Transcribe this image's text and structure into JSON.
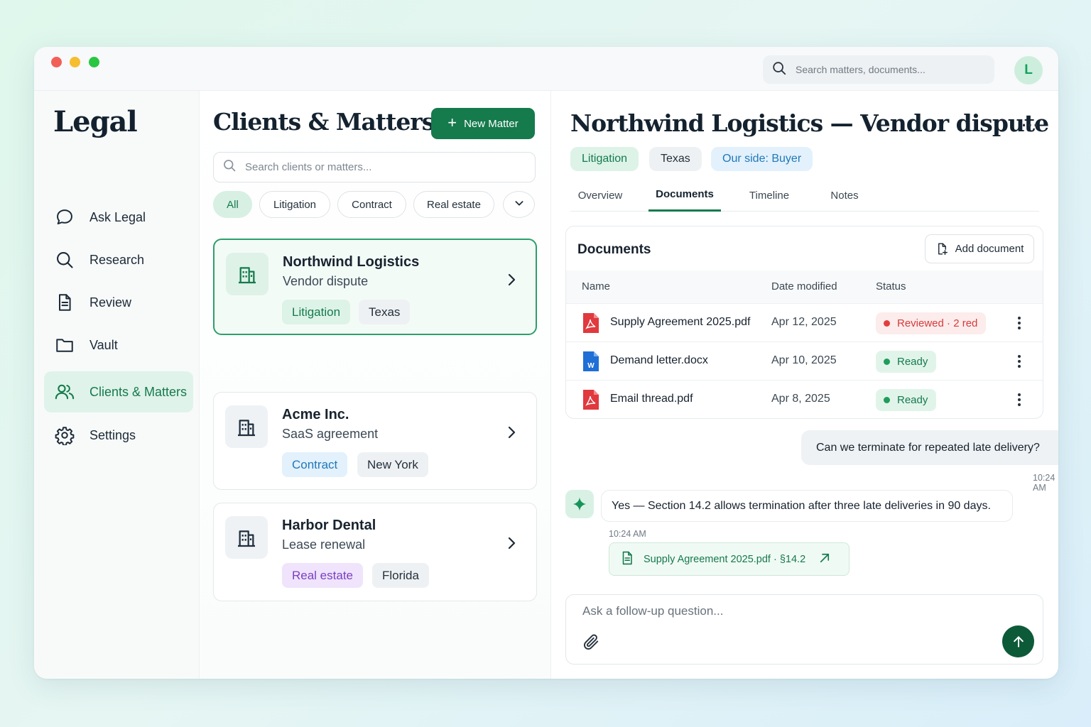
{
  "window": {
    "search_placeholder": "Search matters, documents...",
    "avatar_initial": "L"
  },
  "sidebar": {
    "brand": "Legal",
    "items": [
      {
        "label": "Ask Legal",
        "icon": "chat-bubble-icon"
      },
      {
        "label": "Research",
        "icon": "search-icon"
      },
      {
        "label": "Review",
        "icon": "document-icon"
      },
      {
        "label": "Vault",
        "icon": "folder-icon"
      },
      {
        "label": "Clients & Matters",
        "icon": "users-icon",
        "active": true
      },
      {
        "label": "Settings",
        "icon": "gear-icon"
      }
    ]
  },
  "matters_list": {
    "title": "Clients & Matters",
    "new_button": "New Matter",
    "search_placeholder": "Search clients or matters...",
    "filters": [
      "All",
      "Litigation",
      "Contract",
      "Real estate"
    ],
    "active_filter": "All",
    "cards": [
      {
        "client": "Northwind Logistics",
        "matter": "Vendor dispute",
        "tags": [
          "Litigation",
          "Texas"
        ],
        "selected": true
      },
      {
        "client": "Acme Inc.",
        "matter": "SaaS agreement",
        "tags": [
          "Contract",
          "New York"
        ]
      },
      {
        "client": "Harbor Dental",
        "matter": "Lease renewal",
        "tags": [
          "Real estate",
          "Florida"
        ]
      }
    ]
  },
  "matter_detail": {
    "title": "Northwind Logistics — Vendor dispute",
    "more_label": "···",
    "tags": [
      "Litigation",
      "Texas",
      "Our side: Buyer"
    ],
    "tabs": [
      "Overview",
      "Documents",
      "Timeline",
      "Notes"
    ],
    "active_tab": "Documents",
    "documents": {
      "title": "Documents",
      "add_button": "Add document",
      "columns": [
        "Name",
        "Date modified",
        "Status"
      ],
      "rows": [
        {
          "name": "Supply Agreement 2025.pdf",
          "type_icon": "pdf-file-icon",
          "date": "Apr 12, 2025",
          "status": "Reviewed · 2 red",
          "status_color": "#d43b3b"
        },
        {
          "name": "Demand letter.docx",
          "type_icon": "word-file-icon",
          "date": "Apr 10, 2025",
          "status": "Ready",
          "status_color": "#157a4c"
        },
        {
          "name": "Email thread.pdf",
          "type_icon": "pdf-file-icon",
          "date": "Apr 8, 2025",
          "status": "Ready",
          "status_color": "#157a4c"
        }
      ]
    },
    "chat": {
      "user_message": "Can we terminate for repeated late delivery?",
      "user_time": "10:24 AM",
      "ai_message": "Yes — Section 14.2 allows termination after three late deliveries in 90 days.",
      "ai_time": "10:24 AM",
      "citation": "Supply Agreement 2025.pdf · §14.2",
      "composer_placeholder": "Ask a follow-up question..."
    }
  },
  "colors": {
    "accent": "#157a4c",
    "accent_light": "#dff3ea",
    "danger": "#d43b3b",
    "send_button": "#0d5a39"
  }
}
